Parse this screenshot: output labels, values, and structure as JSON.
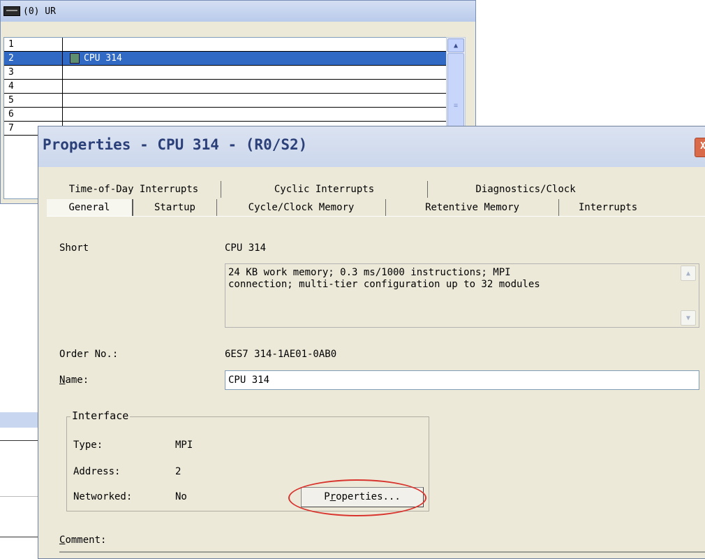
{
  "rack": {
    "title": "(0) UR",
    "rows": [
      {
        "slot": "1",
        "module": ""
      },
      {
        "slot": "2",
        "module": "CPU 314",
        "selected": true
      },
      {
        "slot": "3",
        "module": ""
      },
      {
        "slot": "4",
        "module": ""
      },
      {
        "slot": "5",
        "module": ""
      },
      {
        "slot": "6",
        "module": ""
      },
      {
        "slot": "7",
        "module": ""
      }
    ]
  },
  "dialog": {
    "title": "Properties - CPU 314 - (R0/S2)",
    "close_label": "X",
    "tabs_back": [
      "Time-of-Day Interrupts",
      "Cyclic Interrupts",
      "Diagnostics/Clock"
    ],
    "tabs_front": [
      "General",
      "Startup",
      "Cycle/Clock Memory",
      "Retentive Memory",
      "Interrupts"
    ],
    "active_tab": "General",
    "short_label": "Short",
    "short_value": "CPU 314",
    "description": "24 KB work memory; 0.3 ms/1000 instructions; MPI\nconnection; multi-tier configuration up to 32 modules",
    "order_label": "Order No.:",
    "order_value": "6ES7 314-1AE01-0AB0",
    "name_label_first": "N",
    "name_label_rest": "ame:",
    "name_value": "CPU 314",
    "interface": {
      "legend": "Interface",
      "type_label": "Type:",
      "type_value": "MPI",
      "address_label": "Address:",
      "address_value": "2",
      "networked_label": "Networked:",
      "networked_value": "No",
      "properties_button_pre": "P",
      "properties_button_mnemonic": "r",
      "properties_button_post": "operties..."
    },
    "comment_label_first": "C",
    "comment_label_rest": "omment:"
  },
  "colors": {
    "selection": "#316ac5",
    "dialog_bg": "#ece9d8",
    "title_text": "#2b3f79",
    "highlight_ellipse": "#d9352f"
  }
}
